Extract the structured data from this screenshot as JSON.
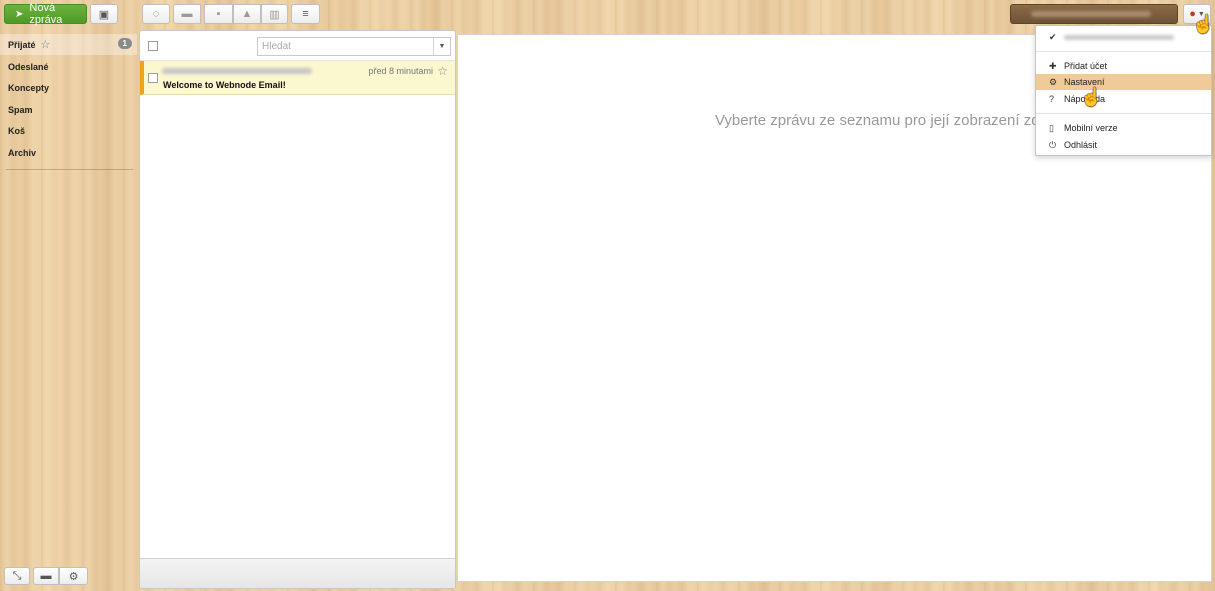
{
  "toolbar": {
    "new_message_label": "Nová zpráva",
    "icons": {
      "new_message": "paper-plane-icon",
      "contacts": "contact-card-icon",
      "refresh": "refresh-icon",
      "move": "folder-icon",
      "archive": "archive-box-icon",
      "spam": "warning-icon",
      "delete": "trash-icon",
      "more": "hamburger-menu-icon",
      "account": "user-icon"
    }
  },
  "sidebar": {
    "folders": [
      {
        "label": "Přijaté",
        "count": "1"
      },
      {
        "label": "Odeslané"
      },
      {
        "label": "Koncepty"
      },
      {
        "label": "Spam"
      },
      {
        "label": "Koš"
      },
      {
        "label": "Archiv"
      }
    ]
  },
  "list": {
    "search_placeholder": "Hledat",
    "messages": [
      {
        "time": "před 8 minutami",
        "subject": "Welcome to Webnode Email!"
      }
    ]
  },
  "preview": {
    "empty_text": "Vyberte zprávu ze seznamu pro její zobrazení zde."
  },
  "account_menu": {
    "items": [
      {
        "label": "Přidat účet",
        "icon": "plus-icon"
      },
      {
        "label": "Nastavení",
        "icon": "gear-icon"
      },
      {
        "label": "Nápověda",
        "icon": "help-icon"
      },
      {
        "label": "Mobilní verze",
        "icon": "mobile-phone-icon"
      },
      {
        "label": "Odhlásit",
        "icon": "power-icon"
      }
    ]
  },
  "colors": {
    "primary_button": "#5aa52f",
    "unread_marker": "#f0a21b",
    "unread_row_bg": "#fbf7cf",
    "menu_hover": "#f1cb97"
  }
}
